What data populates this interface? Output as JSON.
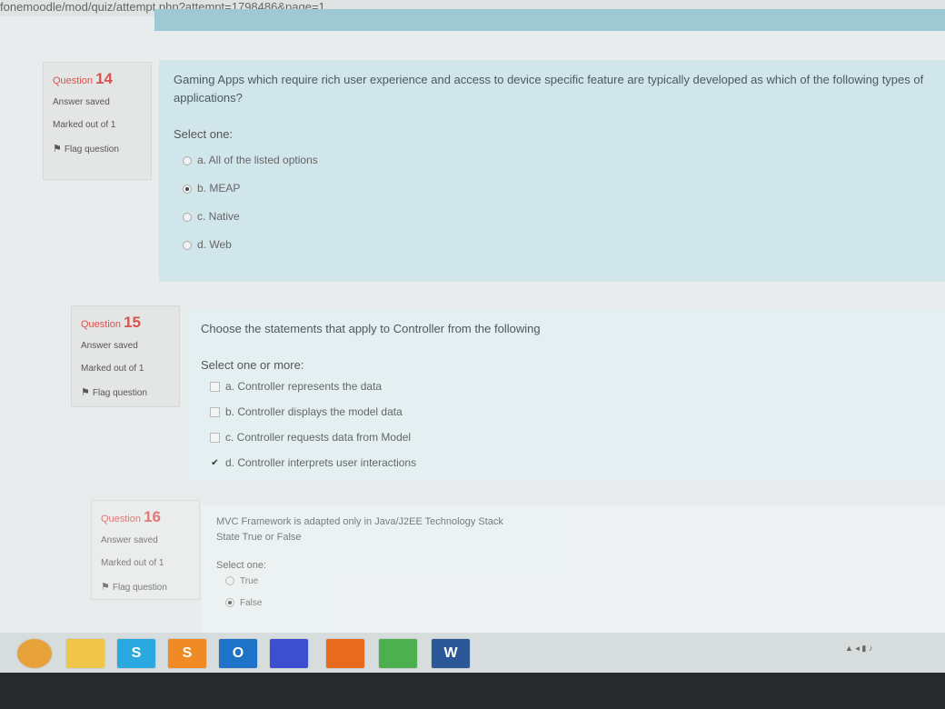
{
  "browser": {
    "url": "fonemoodle/mod/quiz/attempt.php?attempt=1798486&page=1"
  },
  "questions": [
    {
      "label": "Question",
      "number": "14",
      "state": "Answer saved",
      "grade": "Marked out of 1",
      "flag": "Flag question",
      "text": "Gaming Apps which require rich user experience and access to device specific feature are typically developed as which of the following types of applications?",
      "prompt": "Select one:",
      "options": [
        {
          "text": "a. All of the listed options",
          "selected": false
        },
        {
          "text": "b. MEAP",
          "selected": true
        },
        {
          "text": "c. Native",
          "selected": false
        },
        {
          "text": "d. Web",
          "selected": false
        }
      ]
    },
    {
      "label": "Question",
      "number": "15",
      "state": "Answer saved",
      "grade": "Marked out of 1",
      "flag": "Flag question",
      "text": "Choose the statements that apply to Controller from the following",
      "prompt": "Select one or more:",
      "options": [
        {
          "text": "a. Controller represents the data",
          "selected": false
        },
        {
          "text": "b. Controller displays the model data",
          "selected": false
        },
        {
          "text": "c. Controller requests data from Model",
          "selected": false
        },
        {
          "text": "d. Controller interprets user interactions",
          "selected": true
        }
      ]
    },
    {
      "label": "Question",
      "number": "16",
      "state": "Answer saved",
      "grade": "Marked out of 1",
      "flag": "Flag question",
      "text": "MVC Framework is adapted only in Java/J2EE Technology Stack",
      "text2": "State True or False",
      "prompt": "Select one:",
      "options": [
        {
          "text": "True",
          "selected": false
        },
        {
          "text": "False",
          "selected": true
        }
      ]
    }
  ],
  "taskbar": {
    "items": [
      {
        "icon": "start-orb-icon",
        "glyph": "",
        "color": "#e8a23a"
      },
      {
        "icon": "folder-icon",
        "glyph": "",
        "color": "#f0c64a"
      },
      {
        "icon": "skype-icon",
        "glyph": "S",
        "color": "#2aa9e0"
      },
      {
        "icon": "sublime-icon",
        "glyph": "S",
        "color": "#f08a24"
      },
      {
        "icon": "outlook-icon",
        "glyph": "O",
        "color": "#1e72c8"
      },
      {
        "icon": "app-icon",
        "glyph": "",
        "color": "#3b4fd0"
      },
      {
        "icon": "firefox-icon",
        "glyph": "",
        "color": "#e86a1f"
      },
      {
        "icon": "chrome-icon",
        "glyph": "",
        "color": "#4caf50"
      },
      {
        "icon": "word-icon",
        "glyph": "W",
        "color": "#2b5797"
      }
    ]
  }
}
